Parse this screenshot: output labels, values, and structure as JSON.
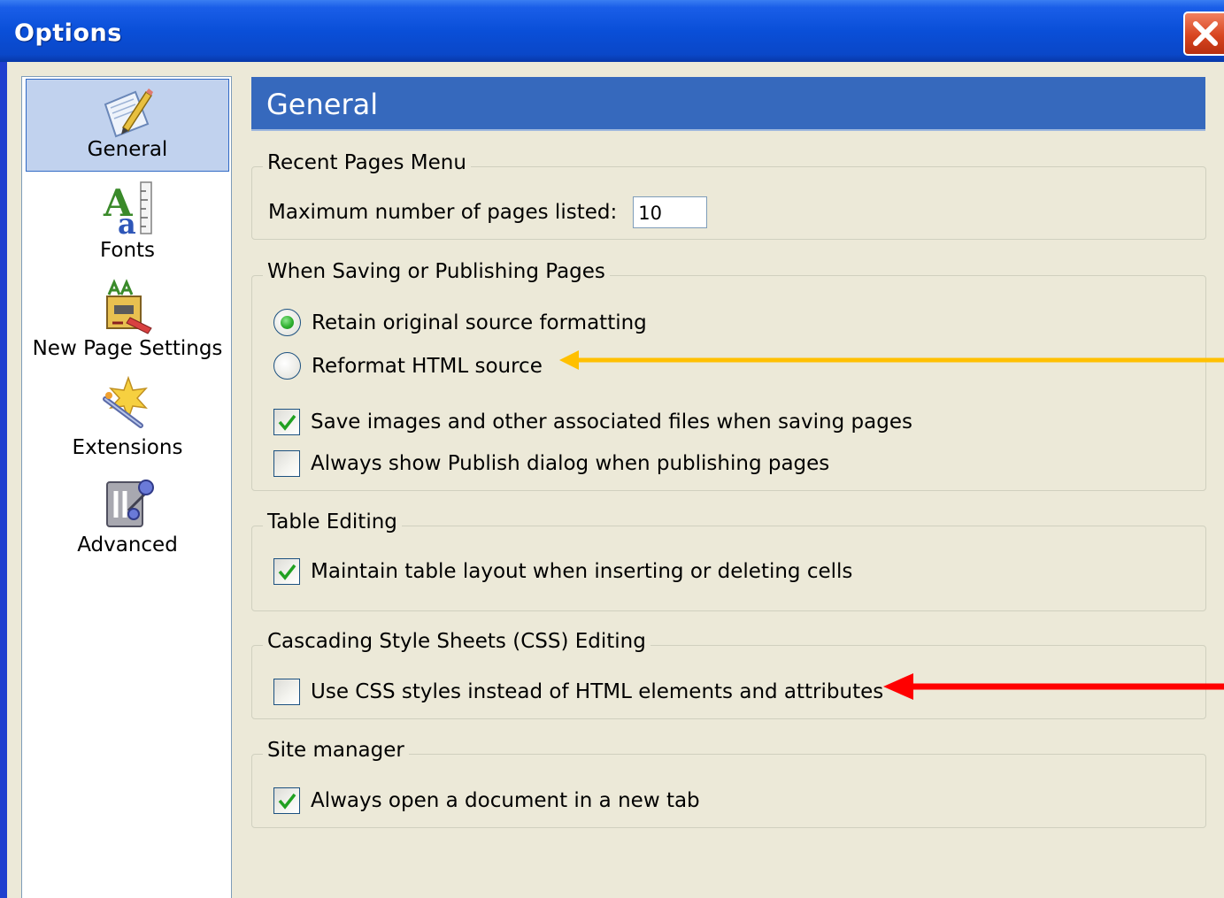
{
  "window": {
    "title": "Options"
  },
  "sidebar": {
    "items": [
      {
        "label": "General",
        "icon": "pencil-paper-icon",
        "selected": true
      },
      {
        "label": "Fonts",
        "icon": "fonts-icon",
        "selected": false
      },
      {
        "label": "New Page Settings",
        "icon": "new-page-settings-icon",
        "selected": false
      },
      {
        "label": "Extensions",
        "icon": "extensions-icon",
        "selected": false
      },
      {
        "label": "Advanced",
        "icon": "advanced-icon",
        "selected": false
      }
    ]
  },
  "panel": {
    "title": "General",
    "recent_pages": {
      "legend": "Recent Pages Menu",
      "max_label": "Maximum number of pages listed:",
      "max_value": "10"
    },
    "saving": {
      "legend": "When Saving or Publishing Pages",
      "retain_label": "Retain original source formatting",
      "retain_selected": true,
      "reformat_label": "Reformat HTML source",
      "reformat_selected": false,
      "save_images_label": "Save images and other associated files when saving pages",
      "save_images_checked": true,
      "publish_dialog_label": "Always show Publish dialog when publishing pages",
      "publish_dialog_checked": false
    },
    "table_editing": {
      "legend": "Table Editing",
      "maintain_label": "Maintain table layout when inserting or deleting cells",
      "maintain_checked": true
    },
    "css_editing": {
      "legend": "Cascading Style Sheets (CSS) Editing",
      "use_css_label": "Use CSS styles instead of HTML elements and attributes",
      "use_css_checked": false
    },
    "site_manager": {
      "legend": "Site manager",
      "open_tab_label": "Always open a document in a new tab",
      "open_tab_checked": true
    }
  },
  "annotations": {
    "arrow_1_color": "#ffc000",
    "arrow_2_color": "#ff0000"
  },
  "colors": {
    "titlebar": "#0a4fd8",
    "header": "#3669bd",
    "dialog_bg": "#ece9d8",
    "check": "#21a121",
    "close": "#d84520"
  }
}
